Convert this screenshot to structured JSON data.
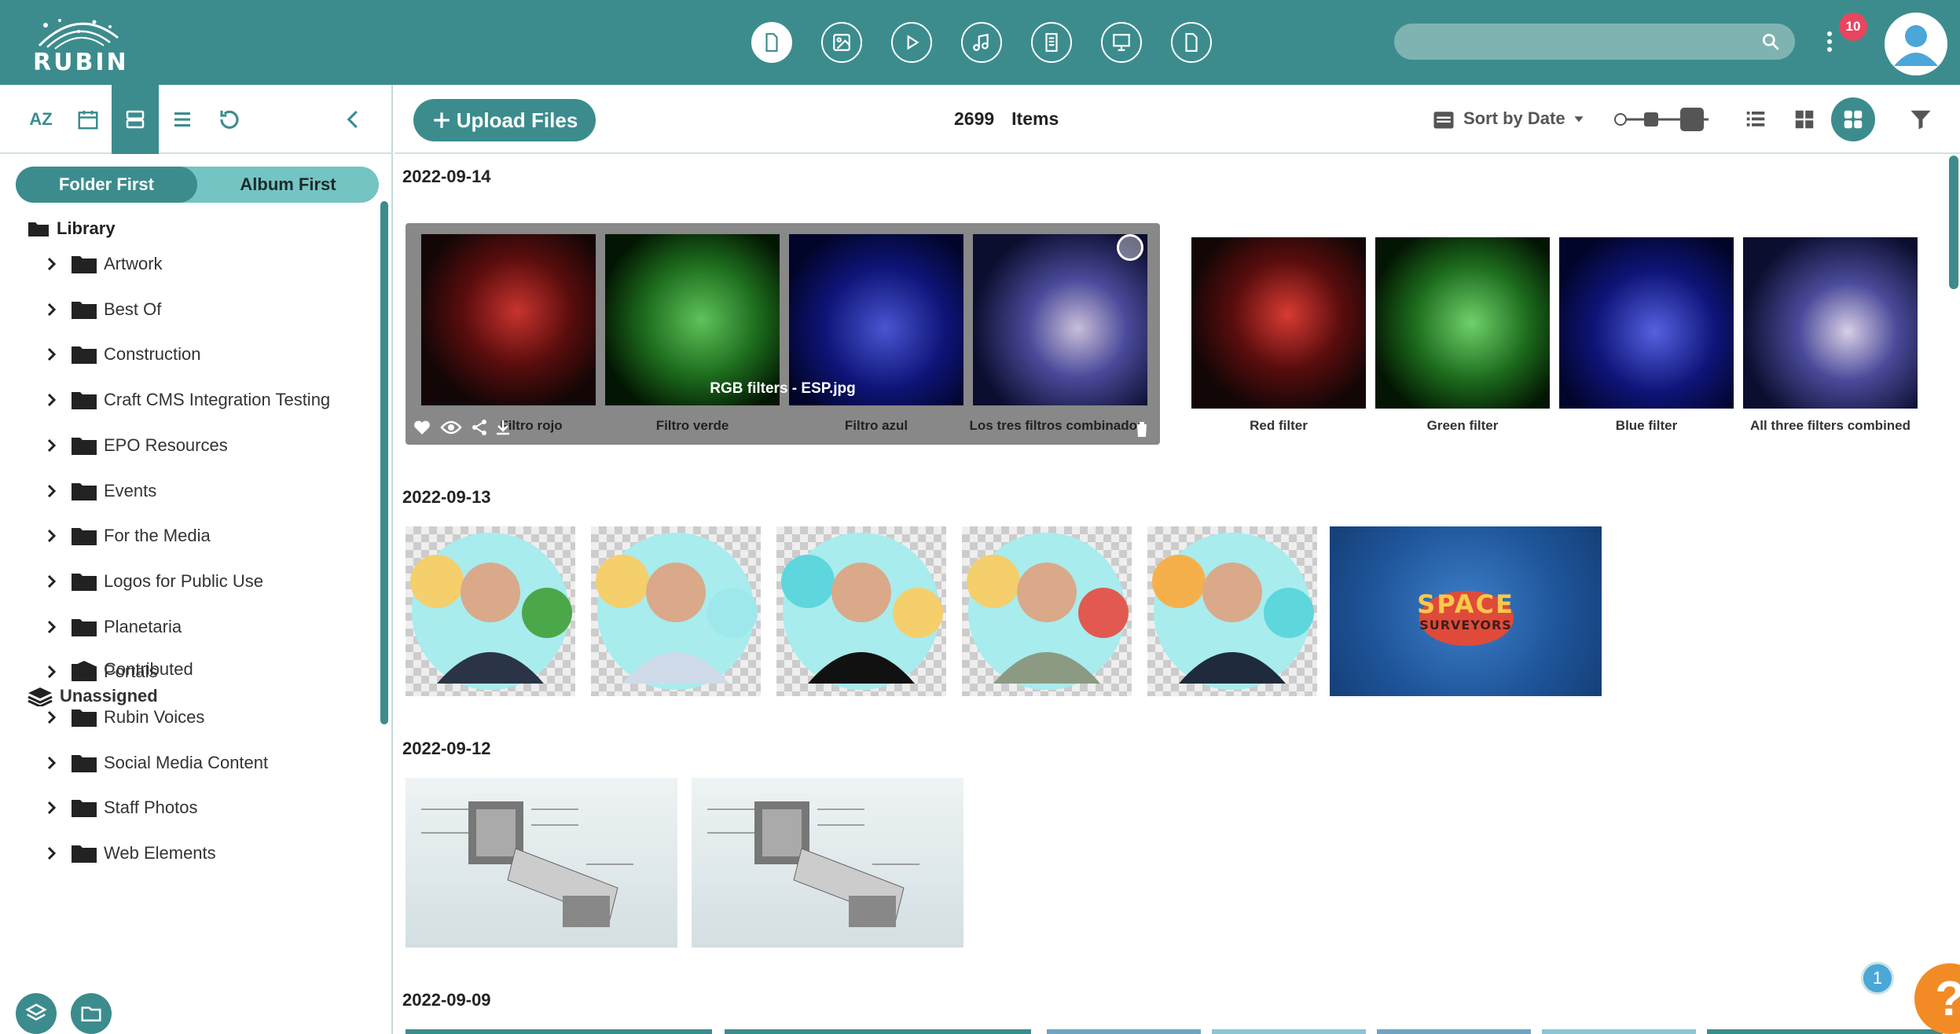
{
  "brand": {
    "name": "RUBIN"
  },
  "topbar": {
    "icons": [
      "all-files-icon",
      "image-icon",
      "video-icon",
      "audio-icon",
      "document-icon",
      "presentation-icon",
      "other-file-icon"
    ],
    "search": {
      "placeholder": "",
      "value": ""
    },
    "notifications": "10"
  },
  "sidebar": {
    "tools": [
      "AZ",
      "calendar-icon",
      "card-view-icon",
      "list-view-icon",
      "refresh-icon",
      "collapse-icon"
    ],
    "toggle": {
      "folder_first": "Folder First",
      "album_first": "Album First"
    },
    "library": "Library",
    "folders": [
      "Artwork",
      "Best Of",
      "Construction",
      "Craft CMS Integration Testing",
      "EPO Resources",
      "Events",
      "For the Media",
      "Logos for Public Use",
      "Planetaria",
      "Portals",
      "Rubin Voices",
      "Social Media Content",
      "Staff Photos",
      "Web Elements"
    ],
    "contributed": "Contributed",
    "unassigned": "Unassigned"
  },
  "toolbar": {
    "upload_label": "Upload Files",
    "item_count": "2699",
    "items_label": "Items",
    "sort_label": "Sort by Date"
  },
  "sections": [
    {
      "date": "2022-09-14"
    },
    {
      "date": "2022-09-13"
    },
    {
      "date": "2022-09-12"
    },
    {
      "date": "2022-09-09"
    }
  ],
  "group1": {
    "selected_title": "RGB filters - ESP.jpg",
    "selected_captions": [
      "Filtro rojo",
      "Filtro verde",
      "Filtro azul",
      "Los tres filtros combinados"
    ],
    "captions": [
      "Red filter",
      "Green filter",
      "Blue filter",
      "All three filters combined"
    ]
  },
  "space_card": {
    "line1": "SPACE",
    "line2": "SURVEYORS"
  },
  "help": {
    "badge": "1",
    "label": "?"
  },
  "colors": {
    "accent": "#3c8c8e",
    "accent_light": "#74c4c3",
    "notification": "#e8465f",
    "help": "#f28b25"
  }
}
